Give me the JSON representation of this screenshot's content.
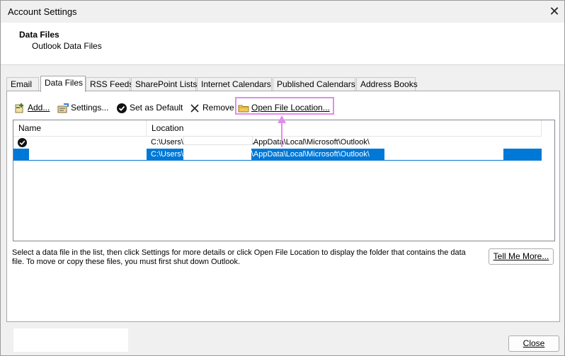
{
  "window": {
    "title": "Account Settings"
  },
  "header": {
    "title": "Data Files",
    "subtitle": "Outlook Data Files"
  },
  "tabs": [
    {
      "label": "Email"
    },
    {
      "label": "Data Files"
    },
    {
      "label": "RSS Feeds"
    },
    {
      "label": "SharePoint Lists"
    },
    {
      "label": "Internet Calendars"
    },
    {
      "label": "Published Calendars"
    },
    {
      "label": "Address Books"
    }
  ],
  "toolbar": {
    "add": {
      "label": "Add...",
      "icon": "add-data-file-icon"
    },
    "settings": {
      "label": "Settings...",
      "icon": "settings-icon"
    },
    "set_default": {
      "label": "Set as Default",
      "icon": "check-circle-icon"
    },
    "remove": {
      "label": "Remove",
      "icon": "x-icon"
    },
    "open_location": {
      "label": "Open File Location...",
      "icon": "folder-icon"
    }
  },
  "list": {
    "columns": [
      "Name",
      "Location"
    ],
    "rows": [
      {
        "default": true,
        "location_prefix": "C:\\Users\\",
        "location_suffix": "\\AppData\\Local\\Microsoft\\Outlook\\"
      },
      {
        "default": false,
        "selected": true,
        "location_prefix": "C:\\Users\\",
        "location_suffix": "\\AppData\\Local\\Microsoft\\Outlook\\"
      }
    ]
  },
  "info_text": "Select a data file in the list, then click Settings for more details or click Open File Location to display the folder that contains the data file. To move or copy these files, you must first shut down Outlook.",
  "buttons": {
    "tell_me_more": "Tell Me More...",
    "close": "Close"
  },
  "colors": {
    "selection": "#0078d7",
    "highlight": "#e38af0"
  }
}
